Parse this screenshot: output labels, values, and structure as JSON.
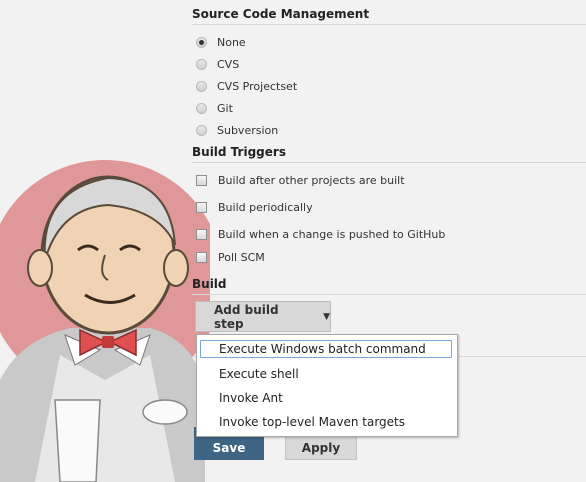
{
  "scm": {
    "title": "Source Code Management",
    "options": [
      {
        "label": "None",
        "checked": true
      },
      {
        "label": "CVS",
        "checked": false
      },
      {
        "label": "CVS Projectset",
        "checked": false
      },
      {
        "label": "Git",
        "checked": false
      },
      {
        "label": "Subversion",
        "checked": false
      }
    ]
  },
  "triggers": {
    "title": "Build Triggers",
    "options": [
      {
        "label": "Build after other projects are built",
        "checked": false
      },
      {
        "label": "Build periodically",
        "checked": false
      },
      {
        "label": "Build when a change is pushed to GitHub",
        "checked": false
      },
      {
        "label": "Poll SCM",
        "checked": false
      }
    ]
  },
  "build": {
    "title": "Build",
    "add_step_label": "Add build step",
    "menu": [
      "Execute Windows batch command",
      "Execute shell",
      "Invoke Ant",
      "Invoke top-level Maven targets"
    ]
  },
  "buttons": {
    "save": "Save",
    "apply": "Apply"
  },
  "colors": {
    "save_bg": "#3e6584",
    "mascot_red": "#d24c4c"
  }
}
